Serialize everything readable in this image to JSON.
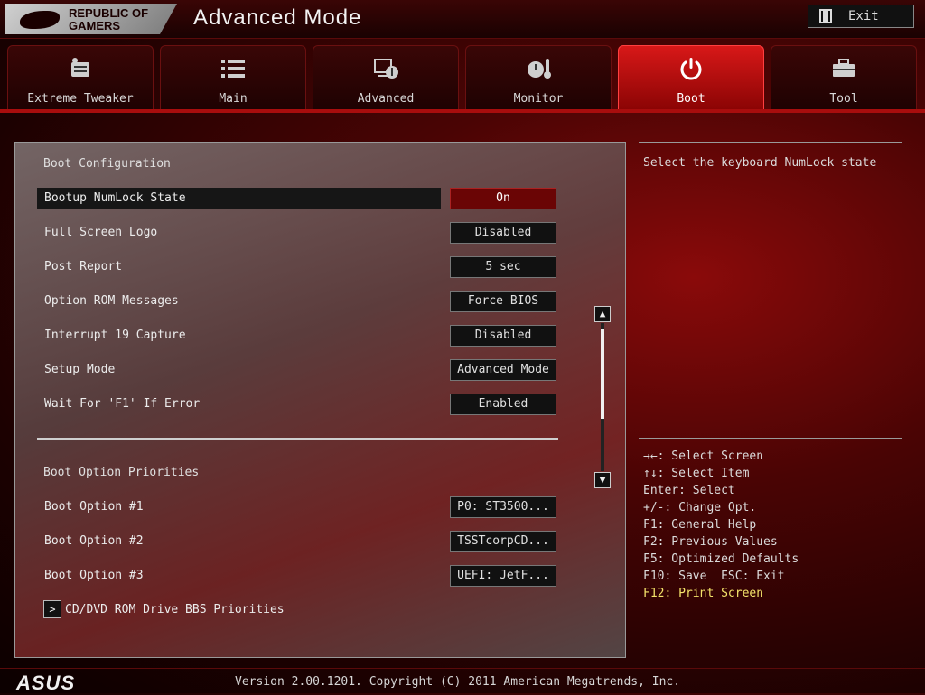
{
  "header": {
    "brand_line1": "REPUBLIC OF",
    "brand_line2": "GAMERS",
    "mode_title": "Advanced Mode",
    "exit_label": "Exit"
  },
  "tabs": [
    {
      "label": "Extreme Tweaker",
      "icon": "tweaker-icon",
      "active": false
    },
    {
      "label": "Main",
      "icon": "list-icon",
      "active": false
    },
    {
      "label": "Advanced",
      "icon": "advanced-info-icon",
      "active": false
    },
    {
      "label": "Monitor",
      "icon": "monitor-gauge-icon",
      "active": false
    },
    {
      "label": "Boot",
      "icon": "power-icon",
      "active": true
    },
    {
      "label": "Tool",
      "icon": "toolbox-icon",
      "active": false
    }
  ],
  "boot_config": {
    "title": "Boot Configuration",
    "rows": [
      {
        "label": "Bootup NumLock State",
        "value": "On",
        "selected": true
      },
      {
        "label": "Full Screen Logo",
        "value": "Disabled"
      },
      {
        "label": "Post Report",
        "value": "5 sec"
      },
      {
        "label": "Option ROM Messages",
        "value": "Force BIOS"
      },
      {
        "label": "Interrupt 19 Capture",
        "value": "Disabled"
      },
      {
        "label": "Setup Mode",
        "value": "Advanced Mode"
      },
      {
        "label": "Wait For 'F1' If Error",
        "value": "Enabled"
      }
    ]
  },
  "boot_priorities": {
    "title": "Boot Option Priorities",
    "rows": [
      {
        "label": "Boot Option #1",
        "value": "P0: ST3500..."
      },
      {
        "label": "Boot Option #2",
        "value": "TSSTcorpCD..."
      },
      {
        "label": "Boot Option #3",
        "value": "UEFI: JetF..."
      }
    ],
    "submenu_arrow": ">",
    "submenu_label": "CD/DVD ROM Drive BBS Priorities"
  },
  "scroll": {
    "up": "▲",
    "down": "▼"
  },
  "help": {
    "description": "Select the keyboard NumLock state",
    "keys": [
      "→←: Select Screen",
      "↑↓: Select Item",
      "Enter: Select",
      "+/-: Change Opt.",
      "F1: General Help",
      "F2: Previous Values",
      "F5: Optimized Defaults",
      "F10: Save  ESC: Exit"
    ],
    "highlight_key": "F12: Print Screen"
  },
  "footer": {
    "brand": "ASUS",
    "version": "Version 2.00.1201. Copyright (C) 2011 American Megatrends, Inc."
  }
}
